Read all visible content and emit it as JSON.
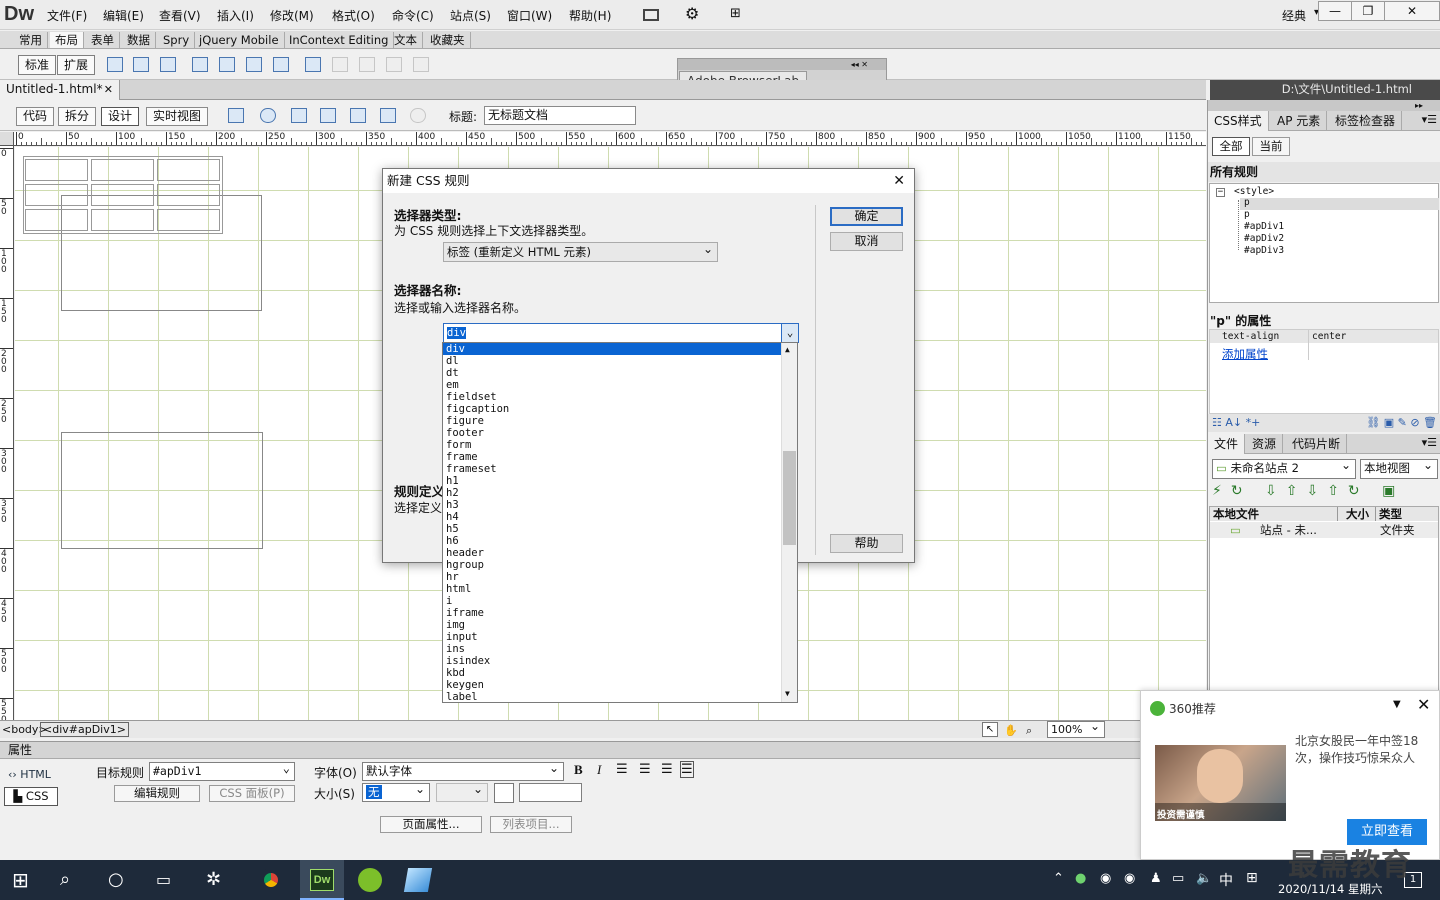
{
  "app": {
    "logo": "Dw",
    "workspace": "经典",
    "workspace_arrow": "▾"
  },
  "menu": [
    "文件(F)",
    "编辑(E)",
    "查看(V)",
    "插入(I)",
    "修改(M)",
    "格式(O)",
    "命令(C)",
    "站点(S)",
    "窗口(W)",
    "帮助(H)"
  ],
  "window_controls": {
    "minimize": "—",
    "restore": "❐",
    "close": "✕"
  },
  "insert_tabs": [
    "常用",
    "布局",
    "表单",
    "数据",
    "Spry",
    "jQuery Mobile",
    "InContext Editing",
    "文本",
    "收藏夹"
  ],
  "insert_toolbar": {
    "standard": "标准",
    "expanded": "扩展"
  },
  "floating_panel": {
    "title": "Adobe BrowserLab"
  },
  "document": {
    "tab": "Untitled-1.html*",
    "close": "✕",
    "path": "D:\\文件\\Untitled-1.html"
  },
  "view_buttons": {
    "code": "代码",
    "split": "拆分",
    "design": "设计",
    "live": "实时视图"
  },
  "title_label": "标题:",
  "title_value": "无标题文档",
  "ruler_marks": [
    "0",
    "50",
    "100",
    "150",
    "200",
    "250",
    "300",
    "350",
    "400",
    "450",
    "500",
    "550",
    "600",
    "650",
    "700",
    "750",
    "800",
    "850",
    "900",
    "950",
    "1000",
    "1050",
    "1100",
    "1150"
  ],
  "vruler_marks": [
    "0",
    "50",
    "100",
    "150",
    "200",
    "250",
    "300",
    "350",
    "400",
    "450",
    "500",
    "550"
  ],
  "status": {
    "tags": [
      "<body>",
      "<div#apDiv1>"
    ],
    "zoom": "100%"
  },
  "properties": {
    "header": "属性",
    "html_btn": "HTML",
    "css_btn": "CSS",
    "target_rule_label": "目标规则",
    "target_rule_value": "#apDiv1",
    "edit_rule": "编辑规则",
    "css_panel": "CSS 面板(P)",
    "font_label": "字体(O)",
    "font_value": "默认字体",
    "size_label": "大小(S)",
    "size_value": "无",
    "bold": "B",
    "italic": "I",
    "page_props": "页面属性...",
    "list_item": "列表项目..."
  },
  "css_panel": {
    "tabs": [
      "CSS样式",
      "AP 元素",
      "标签检查器"
    ],
    "mode": [
      "全部",
      "当前"
    ],
    "all_rules_title": "所有规则",
    "rules": [
      "<style>",
      "p",
      "p",
      "#apDiv1",
      "#apDiv2",
      "#apDiv3"
    ],
    "props_title": "\"p\" 的属性",
    "prop_name": "text-align",
    "prop_value": "center",
    "add_prop": "添加属性"
  },
  "files_panel": {
    "tabs": [
      "文件",
      "资源",
      "代码片断"
    ],
    "site": "未命名站点 2",
    "view": "本地视图",
    "columns": [
      "本地文件",
      "大小",
      "类型"
    ],
    "row_name": "站点 - 未...",
    "row_type": "文件夹"
  },
  "dialog": {
    "title": "新建 CSS 规则",
    "close": "✕",
    "selector_type_label": "选择器类型:",
    "selector_type_desc": "为 CSS 规则选择上下文选择器类型。",
    "selector_type_value": "标签 (重新定义 HTML 元素)",
    "selector_name_label": "选择器名称:",
    "selector_name_desc": "选择或输入选择器名称。",
    "selector_name_value": "div",
    "rule_def_label": "规则定义",
    "rule_def_desc": "选择定义",
    "ok": "确定",
    "cancel": "取消",
    "help": "帮助",
    "options": [
      "div",
      "dl",
      "dt",
      "em",
      "fieldset",
      "figcaption",
      "figure",
      "footer",
      "form",
      "frame",
      "frameset",
      "h1",
      "h2",
      "h3",
      "h4",
      "h5",
      "h6",
      "header",
      "hgroup",
      "hr",
      "html",
      "i",
      "iframe",
      "img",
      "input",
      "ins",
      "isindex",
      "kbd",
      "keygen",
      "label"
    ]
  },
  "popup": {
    "title": "360推荐",
    "headline": "北京女股民一年中签18次，操作技巧惊呆众人",
    "image_caption": "投资需谨慎",
    "cta": "立即查看"
  },
  "watermark": "最需教育",
  "taskbar": {
    "ime": "中",
    "date": "2020/11/14 星期六",
    "notif_count": "1"
  },
  "colors": {
    "accent": "#0a64d2",
    "popup_cta": "#1a82e2",
    "taskbar": "#1e2a3a"
  }
}
